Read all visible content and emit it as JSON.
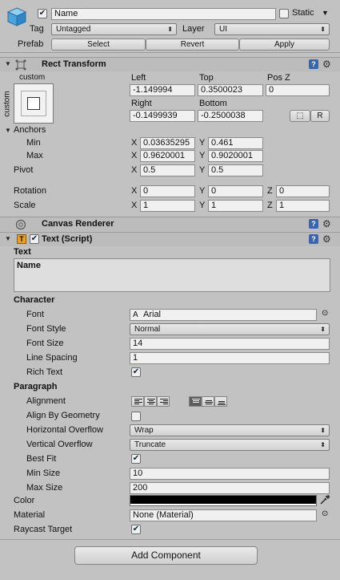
{
  "gameobject": {
    "name": "Name",
    "static_label": "Static",
    "tag_label": "Tag",
    "tag_value": "Untagged",
    "layer_label": "Layer",
    "layer_value": "UI",
    "prefab_label": "Prefab",
    "prefab_select": "Select",
    "prefab_revert": "Revert",
    "prefab_apply": "Apply",
    "active": true,
    "static": false
  },
  "rect_transform": {
    "title": "Rect Transform",
    "anchor_preset_top": "custom",
    "anchor_preset_side": "custom",
    "col_left": "Left",
    "col_top": "Top",
    "col_posz": "Pos Z",
    "left": "-1.149994",
    "top": "0.3500023",
    "posz": "0",
    "col_right": "Right",
    "col_bottom": "Bottom",
    "right": "-0.1499939",
    "bottom": "-0.2500038",
    "blueprint_btn": "⬚",
    "raw_btn": "R",
    "anchors_label": "Anchors",
    "min_label": "Min",
    "min_x": "0.03635295",
    "min_y": "0.461",
    "max_label": "Max",
    "max_x": "0.9620001",
    "max_y": "0.9020001",
    "pivot_label": "Pivot",
    "pivot_x": "0.5",
    "pivot_y": "0.5",
    "rotation_label": "Rotation",
    "rot_x": "0",
    "rot_y": "0",
    "rot_z": "0",
    "scale_label": "Scale",
    "scale_x": "1",
    "scale_y": "1",
    "scale_z": "1",
    "x": "X",
    "y": "Y",
    "z": "Z"
  },
  "canvas_renderer": {
    "title": "Canvas Renderer"
  },
  "text_script": {
    "title": "Text (Script)",
    "text_label": "Text",
    "text_value": "Name",
    "character_label": "Character",
    "font_label": "Font",
    "font_value": "Arial",
    "font_style_label": "Font Style",
    "font_style_value": "Normal",
    "font_size_label": "Font Size",
    "font_size_value": "14",
    "line_spacing_label": "Line Spacing",
    "line_spacing_value": "1",
    "rich_text_label": "Rich Text",
    "rich_text": true,
    "paragraph_label": "Paragraph",
    "alignment_label": "Alignment",
    "align_by_geometry_label": "Align By Geometry",
    "align_by_geometry": false,
    "horizontal_overflow_label": "Horizontal Overflow",
    "horizontal_overflow_value": "Wrap",
    "vertical_overflow_label": "Vertical Overflow",
    "vertical_overflow_value": "Truncate",
    "best_fit_label": "Best Fit",
    "best_fit": true,
    "min_size_label": "Min Size",
    "min_size_value": "10",
    "max_size_label": "Max Size",
    "max_size_value": "200",
    "color_label": "Color",
    "color_value": "#000000",
    "material_label": "Material",
    "material_value": "None (Material)",
    "raycast_label": "Raycast Target",
    "raycast": true
  },
  "add_component": "Add Component",
  "icons": {
    "gameobject": "cube-icon",
    "help": "help-icon",
    "settings": "gear-icon",
    "color_picker": "eyedropper-icon",
    "object_picker": "target-icon"
  }
}
